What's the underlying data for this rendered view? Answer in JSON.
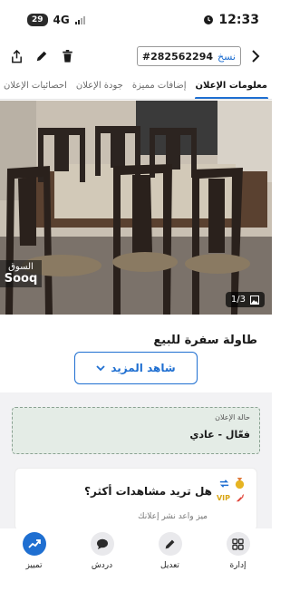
{
  "status_bar": {
    "time": "12:33",
    "network": "4G",
    "battery": "29"
  },
  "toolbar": {
    "ad_id": "#282562294",
    "copy_label": "نسخ"
  },
  "tabs": [
    {
      "label": "معلومات الإعلان",
      "active": true
    },
    {
      "label": "إضافات مميزة",
      "active": false
    },
    {
      "label": "جودة الإعلان",
      "active": false
    },
    {
      "label": "احصائيات الإعلان",
      "active": false
    }
  ],
  "gallery": {
    "watermark_line1": "السوق",
    "watermark_line2": "Sooq",
    "counter": "1/3"
  },
  "ad": {
    "title": "طاولة سفرة للبيع",
    "see_more_label": "شاهد المزيد"
  },
  "ad_status": {
    "label": "حالة الإعلان",
    "value": "فعّال - عادي"
  },
  "promo": {
    "title": "هل تريد مشاهدات أكثر؟",
    "subtitle": "ميز واعد نشر إعلانك",
    "vip_badge": "VIP"
  },
  "bottom_nav": {
    "manage": "إدارة",
    "edit": "تعديل",
    "chat": "دردش",
    "feature": "تمييز"
  },
  "colors": {
    "accent": "#1f6fd1",
    "status_card_bg": "#e4ece6"
  }
}
